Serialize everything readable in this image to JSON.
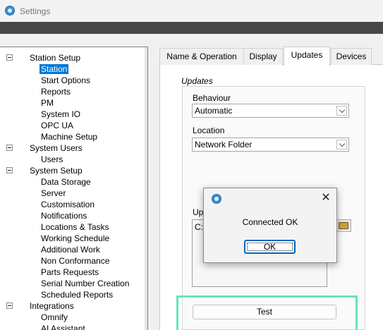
{
  "window": {
    "title": "Settings",
    "icon": "app-icon"
  },
  "tree": {
    "items": [
      {
        "label": "Station Setup",
        "level": 0,
        "expanded": true
      },
      {
        "label": "Station",
        "level": 1,
        "selected": true
      },
      {
        "label": "Start Options",
        "level": 1
      },
      {
        "label": "Reports",
        "level": 1
      },
      {
        "label": "PM",
        "level": 1
      },
      {
        "label": "System IO",
        "level": 1
      },
      {
        "label": "OPC UA",
        "level": 1
      },
      {
        "label": "Machine Setup",
        "level": 1
      },
      {
        "label": "System Users",
        "level": 0,
        "expanded": true
      },
      {
        "label": "Users",
        "level": 1
      },
      {
        "label": "System Setup",
        "level": 0,
        "expanded": true
      },
      {
        "label": "Data Storage",
        "level": 1
      },
      {
        "label": "Server",
        "level": 1
      },
      {
        "label": "Customisation",
        "level": 1
      },
      {
        "label": "Notifications",
        "level": 1
      },
      {
        "label": "Locations & Tasks",
        "level": 1
      },
      {
        "label": "Working Schedule",
        "level": 1
      },
      {
        "label": "Additional Work",
        "level": 1
      },
      {
        "label": "Non Conformance",
        "level": 1
      },
      {
        "label": "Parts Requests",
        "level": 1
      },
      {
        "label": "Serial Number Creation",
        "level": 1
      },
      {
        "label": "Scheduled Reports",
        "level": 1
      },
      {
        "label": "Integrations",
        "level": 0,
        "expanded": true
      },
      {
        "label": "Omnify",
        "level": 1
      },
      {
        "label": "AI Assistant",
        "level": 1
      }
    ]
  },
  "tabs": [
    {
      "label": "Name & Operation"
    },
    {
      "label": "Display"
    },
    {
      "label": "Updates",
      "active": true
    },
    {
      "label": "Devices"
    }
  ],
  "updates": {
    "group_title": "Updates",
    "behaviour_label": "Behaviour",
    "behaviour_value": "Automatic",
    "location_label": "Location",
    "location_value": "Network Folder",
    "path_label_partial": "Up",
    "path_value_partial": "C:",
    "test_label": "Test"
  },
  "dialog": {
    "message": "Connected OK",
    "ok_label": "OK",
    "close_glyph": "✕"
  },
  "colors": {
    "selection": "#0078d7",
    "highlight_box": "#64e4bd",
    "title_dark_bar": "#474747",
    "dialog_default_border": "#0067c0"
  }
}
